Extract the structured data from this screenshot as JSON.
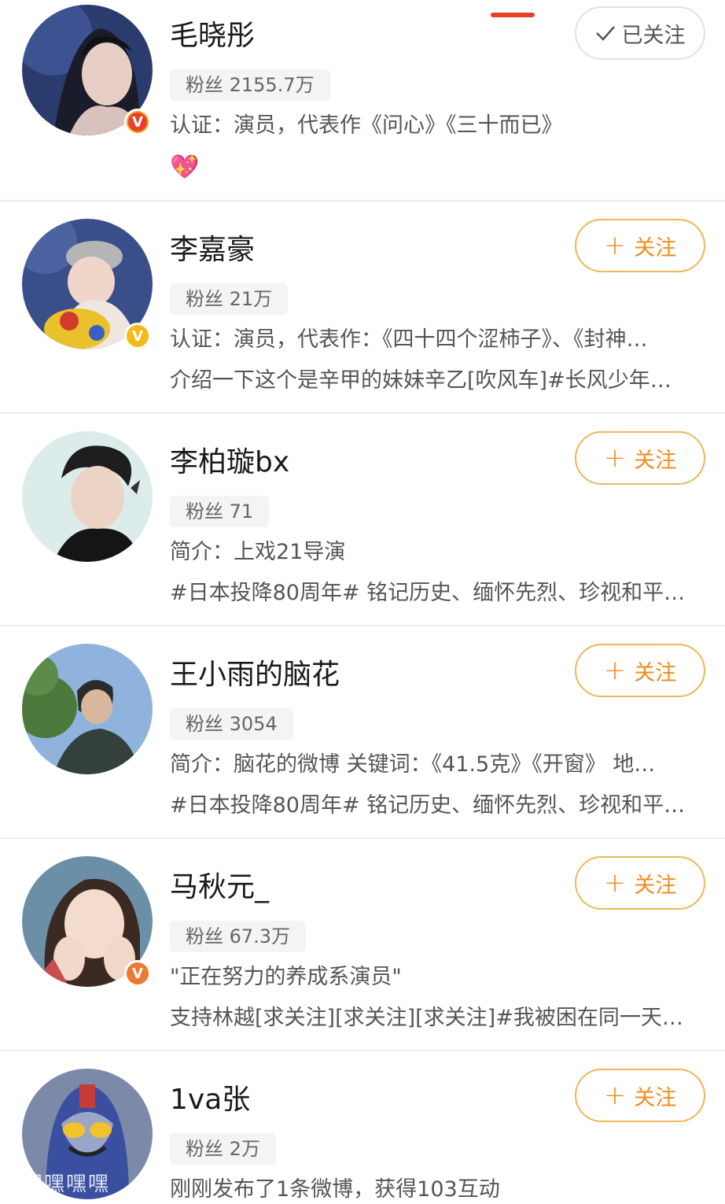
{
  "users": [
    {
      "name": "毛晓彤",
      "fans": "粉丝 2155.7万",
      "line1": "认证：演员，代表作《问心》《三十而已》",
      "line2": "💖",
      "button": "已关注",
      "followed": true,
      "badge": "V",
      "badge_color": "#e8402a"
    },
    {
      "name": "李嘉豪",
      "fans": "粉丝 21万",
      "line1": "认证：演员，代表作：《四十四个涩柿子》、《封神…",
      "line2": "介绍一下这个是辛甲的妹妹辛乙[吹风车]#长风少年…",
      "button": "关注",
      "followed": false,
      "badge": "V",
      "badge_color": "#f6b918"
    },
    {
      "name": "李柏璇bx",
      "fans": "粉丝 71",
      "line1": "简介：上戏21导演",
      "line2": "#日本投降80周年# 铭记历史、缅怀先烈、珍视和平…",
      "button": "关注",
      "followed": false
    },
    {
      "name": "王小雨的脑花",
      "fans": "粉丝 3054",
      "line1": "简介：脑花的微博 关键词：《41.5克》《开窗》 地…",
      "line2": "#日本投降80周年# 铭记历史、缅怀先烈、珍视和平…",
      "button": "关注",
      "followed": false
    },
    {
      "name": "马秋元_",
      "fans": "粉丝 67.3万",
      "line1": "\"正在努力的养成系演员\"",
      "line2": "支持林越[求关注][求关注][求关注]#我被困在同一天…",
      "button": "关注",
      "followed": false,
      "badge": "V",
      "badge_color": "#f07830"
    },
    {
      "name": "1va张",
      "fans": "粉丝 2万",
      "line1": "刚刚发布了1条微博，获得103互动",
      "avatar_text": "嘿嘿嘿嘿",
      "button": "关注",
      "followed": false
    }
  ],
  "icons": {
    "plus": "plus-icon",
    "check": "check-icon",
    "verified": "verified-badge-icon"
  },
  "colors": {
    "accent": "#ef8d1d",
    "follow_border": "#f0b659",
    "tab_indicator": "#e8402a"
  }
}
